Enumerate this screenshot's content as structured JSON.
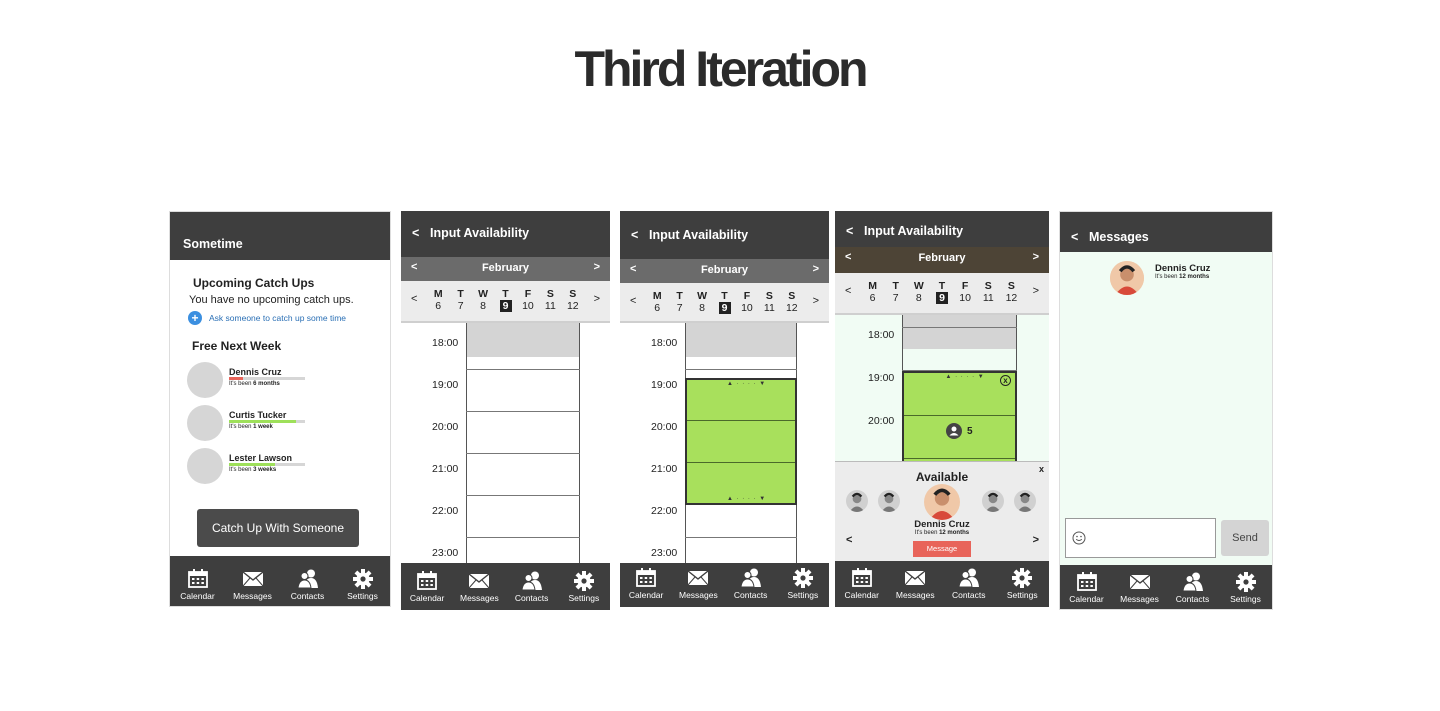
{
  "page": {
    "title": "Third Iteration"
  },
  "tabs": [
    "Calendar",
    "Messages",
    "Contacts",
    "Settings"
  ],
  "screen1": {
    "header": "Sometime",
    "upcoming_title": "Upcoming Catch Ups",
    "upcoming_empty": "You have no upcoming catch ups.",
    "ask_link": "Ask someone to catch up some time",
    "free_title": "Free Next Week",
    "contacts": [
      {
        "name": "Dennis Cruz",
        "prefix": "It's been",
        "duration": "6 months",
        "progress": 0.18,
        "color": "#e8645a"
      },
      {
        "name": "Curtis Tucker",
        "prefix": "It's been",
        "duration": "1 week",
        "progress": 0.88,
        "color": "#9ee05a"
      },
      {
        "name": "Lester Lawson",
        "prefix": "It's been",
        "duration": "3 weeks",
        "progress": 0.6,
        "color": "#9ee05a"
      }
    ],
    "cta": "Catch Up With Someone"
  },
  "availability": {
    "back": "<",
    "title": "Input Availability",
    "month": "February",
    "prev": "<",
    "next": ">",
    "days": [
      {
        "n": "M",
        "d": "6"
      },
      {
        "n": "T",
        "d": "7"
      },
      {
        "n": "W",
        "d": "8"
      },
      {
        "n": "T",
        "d": "9"
      },
      {
        "n": "F",
        "d": "10"
      },
      {
        "n": "S",
        "d": "11"
      },
      {
        "n": "S",
        "d": "12"
      }
    ],
    "times": [
      "18:00",
      "19:00",
      "20:00",
      "21:00",
      "22:00",
      "23:00"
    ],
    "times_short": [
      "18:00",
      "19:00",
      "20:00"
    ]
  },
  "screen4": {
    "people_count": "5",
    "available_title": "Available",
    "close": "x",
    "remove": "x",
    "person_name": "Dennis Cruz",
    "person_prefix": "It's been",
    "person_duration": "12 months",
    "message_button": "Message"
  },
  "screen5": {
    "back": "<",
    "title": "Messages",
    "name": "Dennis Cruz",
    "prefix": "It's been",
    "duration": "12 months",
    "send": "Send",
    "input_placeholder": ""
  },
  "colors": {
    "dark": "#3e3e3e",
    "green": "#a8e05c",
    "accent": "#e8645a",
    "message_bg": "#f1fcf4",
    "month_brown": "#4d4436"
  }
}
